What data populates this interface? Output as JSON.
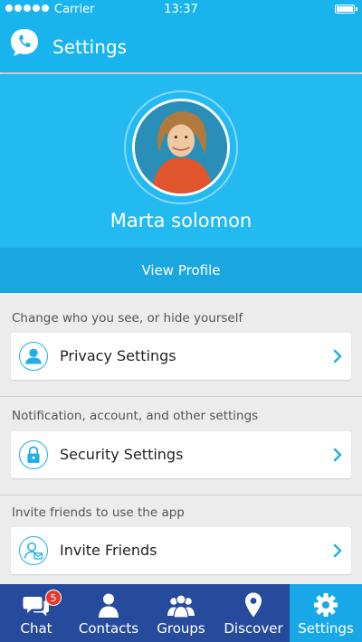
{
  "status_bar": {
    "carrier": "Carrier",
    "time": "13:37"
  },
  "header": {
    "title": "Settings",
    "logo_icon": "phone-bubble-icon"
  },
  "profile": {
    "name": "Marta solomon",
    "view_profile_label": "View Profile"
  },
  "sections": [
    {
      "caption": "Change who you see, or hide yourself",
      "item_label": "Privacy Settings",
      "icon": "user-icon"
    },
    {
      "caption": "Notification, account, and other settings",
      "item_label": "Security Settings",
      "icon": "lock-icon"
    },
    {
      "caption": "Invite friends to use the app",
      "item_label": "Invite Friends",
      "icon": "invite-user-icon"
    }
  ],
  "tabs": [
    {
      "label": "Chat",
      "icon": "chat-icon",
      "badge": "5"
    },
    {
      "label": "Contacts",
      "icon": "contact-icon"
    },
    {
      "label": "Groups",
      "icon": "groups-icon"
    },
    {
      "label": "Discover",
      "icon": "location-pin-icon"
    },
    {
      "label": "Settings",
      "icon": "gear-icon",
      "active": true
    }
  ],
  "colors": {
    "header": "#19b4ee",
    "profile_bg": "#22baf0",
    "view_profile_bg": "#1aa6e0",
    "tab_bar": "#274b9c",
    "tab_active": "#18a8e8",
    "accent": "#22aee8",
    "badge": "#e53b2e"
  }
}
